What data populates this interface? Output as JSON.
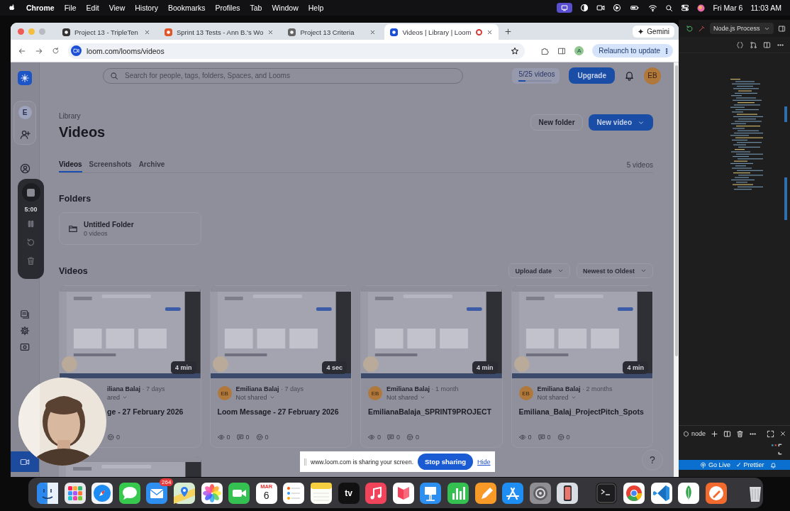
{
  "menu_bar": {
    "app": "Chrome",
    "menus": [
      "File",
      "Edit",
      "View",
      "History",
      "Bookmarks",
      "Profiles",
      "Tab",
      "Window",
      "Help"
    ],
    "date": "Fri Mar 6",
    "time": "11:03 AM"
  },
  "browser": {
    "tabs": [
      {
        "title": "Project 13 - TripleTen",
        "selected": false,
        "recording": false
      },
      {
        "title": "Sprint 13 Tests - Ann B.'s Wo",
        "selected": false,
        "recording": false
      },
      {
        "title": "Project 13 Criteria",
        "selected": false,
        "recording": false
      },
      {
        "title": "Videos | Library | Loom",
        "selected": true,
        "recording": true
      }
    ],
    "gemini": "Gemini",
    "url": "loom.com/looms/videos",
    "profile_initial": "A",
    "relaunch": "Relaunch to update"
  },
  "loom": {
    "search_placeholder": "Search for people, tags, folders, Spaces, and Looms",
    "quota": {
      "label": "5/25 videos",
      "level": 0.2
    },
    "upgrade": "Upgrade",
    "user_initials": "EB",
    "workspace_initial": "E",
    "breadcrumb": "Library",
    "title": "Videos",
    "new_folder": "New folder",
    "new_video": "New video",
    "tabs": [
      {
        "label": "Videos",
        "selected": true
      },
      {
        "label": "Screenshots",
        "selected": false
      },
      {
        "label": "Archive",
        "selected": false
      }
    ],
    "video_count": "5 videos",
    "folders_heading": "Folders",
    "folders": [
      {
        "name": "Untitled Folder",
        "count": "0 videos"
      }
    ],
    "videos_heading": "Videos",
    "sort": [
      "Upload date",
      "Newest to Oldest"
    ],
    "videos": [
      {
        "kind": "covered",
        "duration": "4 min",
        "author": "iliana Balaj",
        "age": "· 7 days",
        "sharing": "ared",
        "title": "ge - 27 February 2026",
        "stats": [
          {
            "kind": "reactions",
            "count": "0"
          }
        ]
      },
      {
        "kind": "full",
        "duration": "4 sec",
        "avatar": "EB",
        "author": "Emiliana Balaj",
        "age": "· 7 days",
        "sharing": "Not shared",
        "title": "Loom Message - 27 February 2026",
        "stats": [
          {
            "kind": "views",
            "count": "0"
          },
          {
            "kind": "comments",
            "count": "0"
          },
          {
            "kind": "reactions",
            "count": "0"
          }
        ]
      },
      {
        "kind": "full",
        "duration": "4 min",
        "avatar": "EB",
        "author": "Emiliana Balaj",
        "age": "· 1 month",
        "sharing": "Not shared",
        "title": "EmilianaBalaja_SPRINT9PROJECT",
        "stats": [
          {
            "kind": "views",
            "count": "0"
          },
          {
            "kind": "comments",
            "count": "0"
          },
          {
            "kind": "reactions",
            "count": "0"
          }
        ]
      },
      {
        "kind": "full",
        "duration": "4 min",
        "avatar": "EB",
        "author": "Emiliana Balaj",
        "age": "· 2 months",
        "sharing": "Not shared",
        "title": "Emiliana_Balaj_ProjectPitch_Spots",
        "stats": [
          {
            "kind": "views",
            "count": "0"
          },
          {
            "kind": "comments",
            "count": "0"
          },
          {
            "kind": "reactions",
            "count": "0"
          }
        ]
      }
    ],
    "more_videos": [
      {
        "kind": "picture"
      }
    ],
    "recorder": {
      "timer": "5:00"
    },
    "share_bar": {
      "message": "www.loom.com is sharing your screen.",
      "stop": "Stop sharing",
      "hide": "Hide"
    },
    "help": "?"
  },
  "editor": {
    "run_config": "Node.js Process",
    "terminal": "node",
    "status": [
      "Go Live",
      "✓ Prettier"
    ]
  },
  "dock": {
    "mail_badge": "264",
    "calendar_month": "MAR",
    "calendar_day": "6",
    "tv_label": "tv"
  }
}
